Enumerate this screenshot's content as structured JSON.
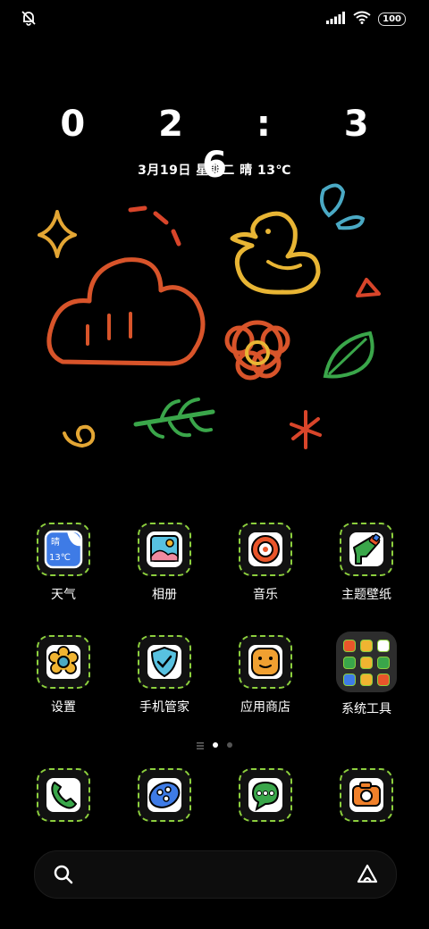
{
  "status_bar": {
    "left_icon": "notification-muted-icon",
    "signal_icon": "cellular-signal-icon",
    "wifi_icon": "wifi-icon",
    "battery_level": "100"
  },
  "clock": {
    "time": "0 2 : 3 6"
  },
  "date": {
    "text": "3月19日  星期二  晴  13℃"
  },
  "weather_icon": {
    "condition": "晴",
    "temp": "13℃"
  },
  "apps": {
    "row1": [
      {
        "label": "天气",
        "icon": "weather-icon"
      },
      {
        "label": "相册",
        "icon": "gallery-icon"
      },
      {
        "label": "音乐",
        "icon": "music-icon"
      },
      {
        "label": "主题壁纸",
        "icon": "themes-icon"
      }
    ],
    "row2": [
      {
        "label": "设置",
        "icon": "settings-icon"
      },
      {
        "label": "手机管家",
        "icon": "security-icon"
      },
      {
        "label": "应用商店",
        "icon": "app-store-icon"
      },
      {
        "label": "系统工具",
        "icon": "folder-icon"
      }
    ]
  },
  "dock": [
    {
      "icon": "phone-icon"
    },
    {
      "icon": "browser-icon"
    },
    {
      "icon": "messages-icon"
    },
    {
      "icon": "camera-icon"
    }
  ],
  "page_indicator": {
    "pages": 3,
    "active": 2
  },
  "search": {
    "icon": "search-icon",
    "assistant_icon": "assistant-icon"
  },
  "colors": {
    "tile_border": "#8ccf3d",
    "orange": "#e9552a",
    "yellow": "#f0b431",
    "green": "#3aa64a",
    "blue": "#3e7be6",
    "teal": "#4aa9c4"
  }
}
